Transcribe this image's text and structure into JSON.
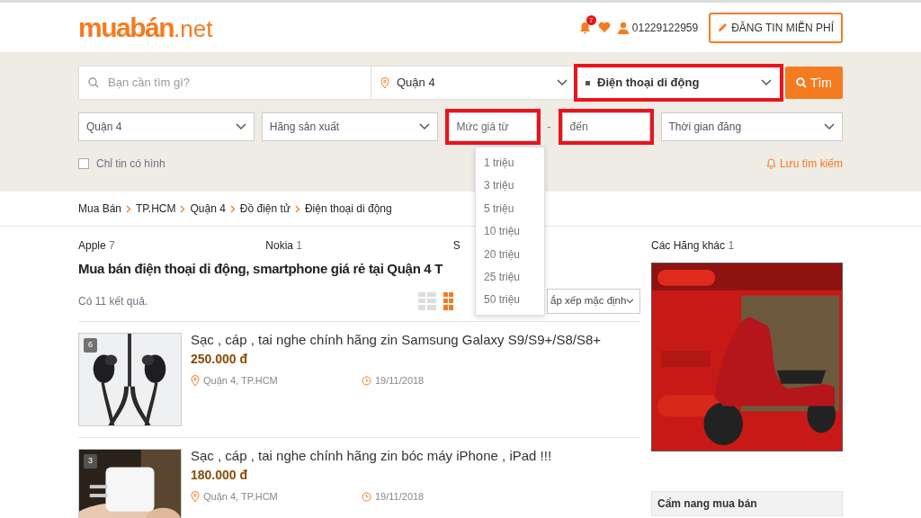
{
  "header": {
    "logo_main": "muabán",
    "logo_suffix": ".net",
    "notification_count": "7",
    "phone": "01229122959",
    "post_button": "ĐĂNG TIN MIỄN PHÍ"
  },
  "search": {
    "query_placeholder": "Bạn cần tìm gì?",
    "location": "Quận 4",
    "category": "Điện thoại di động",
    "category_highlighted": true,
    "button": "Tìm"
  },
  "filters": [
    {
      "kind": "select",
      "label": "Quận 4",
      "highlighted": false
    },
    {
      "kind": "select",
      "label": "Hãng sản xuất",
      "highlighted": false
    },
    {
      "kind": "input",
      "placeholder": "Mức giá từ",
      "highlighted": true
    },
    {
      "kind": "separator",
      "label": "-"
    },
    {
      "kind": "input",
      "placeholder": "đến",
      "highlighted": true
    },
    {
      "kind": "select",
      "label": "Thời gian đăng",
      "highlighted": false
    }
  ],
  "photo_only": {
    "label": "Chỉ tin có hình",
    "checked": false
  },
  "save_search": "Lưu tìm kiếm",
  "price_dropdown": [
    "1 triệu",
    "3 triệu",
    "5 triệu",
    "10 triệu",
    "20 triệu",
    "25 triệu",
    "50 triệu"
  ],
  "breadcrumb": [
    "Mua Bán",
    "TP.HCM",
    "Quận 4",
    "Đồ điện tử",
    "Điện thoại di động"
  ],
  "brands": [
    {
      "name": "Apple",
      "count": "7"
    },
    {
      "name": "Nokia",
      "count": "1"
    },
    {
      "name": "S"
    }
  ],
  "heading": "Mua bán điện thoại di động, smartphone giá rẻ tại Quận 4 T",
  "result_count": "Có 11 kết quả.",
  "views": [
    {
      "kind": "list",
      "selected": false
    },
    {
      "kind": "grid",
      "selected": true
    }
  ],
  "sort": "ắp xếp mặc định",
  "listings": [
    {
      "title": "Sạc , cáp , tai nghe chính hãng zin Samsung Galaxy S9/S9+/S8/S8+",
      "price": "250.000 đ",
      "location": "Quận 4, TP.HCM",
      "date": "19/11/2018",
      "photo_count": "6",
      "kind": "picture"
    },
    {
      "title": "Sạc , cáp , tai nghe chính hãng zin bóc máy iPhone , iPad !!!",
      "price": "180.000 đ",
      "location": "Quận 4, TP.HCM",
      "date": "19/11/2018",
      "photo_count": "3",
      "kind": "picture"
    }
  ],
  "sidebar": {
    "brand": {
      "name": "Các Hãng khác",
      "count": "1"
    },
    "guide_title": "Cẩm nang mua bán"
  }
}
